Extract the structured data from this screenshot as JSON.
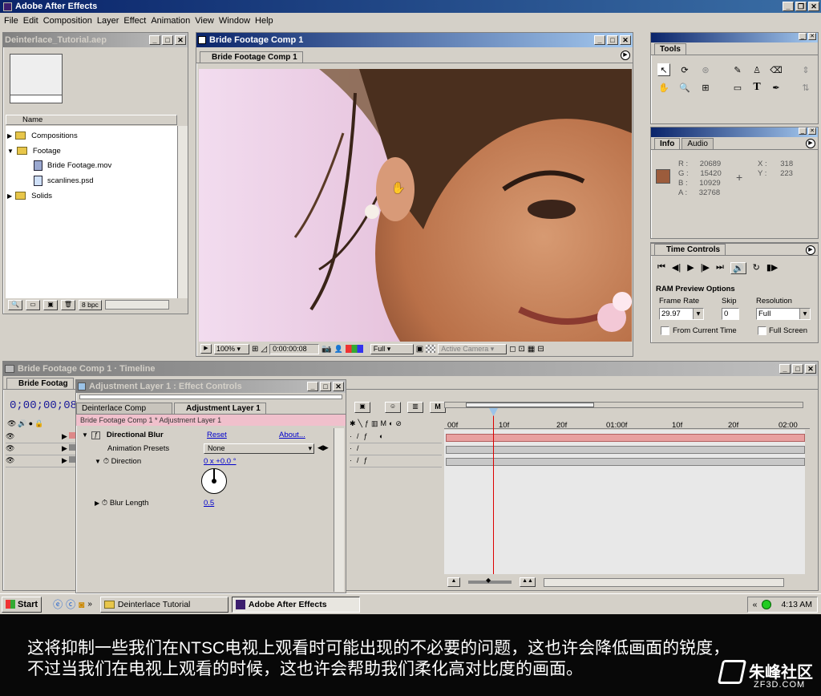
{
  "app": {
    "title": "Adobe After Effects",
    "menu": [
      "File",
      "Edit",
      "Composition",
      "Layer",
      "Effect",
      "Animation",
      "View",
      "Window",
      "Help"
    ]
  },
  "project": {
    "title": "Deinterlace_Tutorial.aep",
    "column": "Name",
    "items": [
      {
        "label": "Compositions",
        "kind": "folder",
        "tw": "right"
      },
      {
        "label": "Footage",
        "kind": "folder",
        "tw": "down"
      },
      {
        "label": "Bride Footage.mov",
        "kind": "movie",
        "tw": ""
      },
      {
        "label": "scanlines.psd",
        "kind": "psd",
        "tw": ""
      },
      {
        "label": "Solids",
        "kind": "folder",
        "tw": "right"
      }
    ],
    "bpc": "8 bpc"
  },
  "comp": {
    "title": "Bride Footage Comp 1",
    "tab": "Bride Footage Comp 1",
    "zoom": "100%",
    "timecode": "0:00:00:08",
    "resolution": "Full",
    "camera": "Active Camera"
  },
  "tools": {
    "title": "Tools"
  },
  "info": {
    "tabs": [
      "Info",
      "Audio"
    ],
    "swatch": "#9c5c3c",
    "R": "20689",
    "G": "15420",
    "B": "10929",
    "A": "32768",
    "X": "318",
    "Y": "223"
  },
  "timecontrols": {
    "title": "Time Controls",
    "ram": "RAM Preview Options",
    "frame_rate_label": "Frame Rate",
    "frame_rate": "29.97",
    "skip_label": "Skip",
    "skip": "0",
    "res_label": "Resolution",
    "res": "Full",
    "from_current": "From Current Time",
    "full_screen": "Full Screen"
  },
  "timeline": {
    "title": "Bride Footage Comp 1 · Timeline",
    "tab": "Bride Footag",
    "timecode": "0;00;00;08",
    "ruler": [
      "00f",
      "10f",
      "20f",
      "01:00f",
      "10f",
      "20f",
      "02:00"
    ]
  },
  "effects": {
    "title": "Adjustment Layer 1 : Effect Controls",
    "tabs": [
      "Deinterlace Comp",
      "Adjustment Layer 1"
    ],
    "breadcrumb": "Bride Footage Comp 1 * Adjustment Layer 1",
    "effect": "Directional Blur",
    "reset": "Reset",
    "about": "About...",
    "presets_label": "Animation Presets",
    "presets": "None",
    "direction_label": "Direction",
    "direction": "0 x +0.0 °",
    "blur_label": "Blur Length",
    "blur": "0.5"
  },
  "taskbar": {
    "start": "Start",
    "items": [
      "Deinterlace Tutorial",
      "Adobe After Effects"
    ],
    "time": "4:13 AM"
  },
  "subtitle": {
    "line1": "这将抑制一些我们在NTSC电视上观看时可能出现的不必要的问题，这也许会降低画面的锐度，",
    "line2": "不过当我们在电视上观看的时候，这也许会帮助我们柔化高对比度的画面。"
  },
  "watermark": {
    "cn": "朱峰社区",
    "url": "ZF3D.COM"
  }
}
